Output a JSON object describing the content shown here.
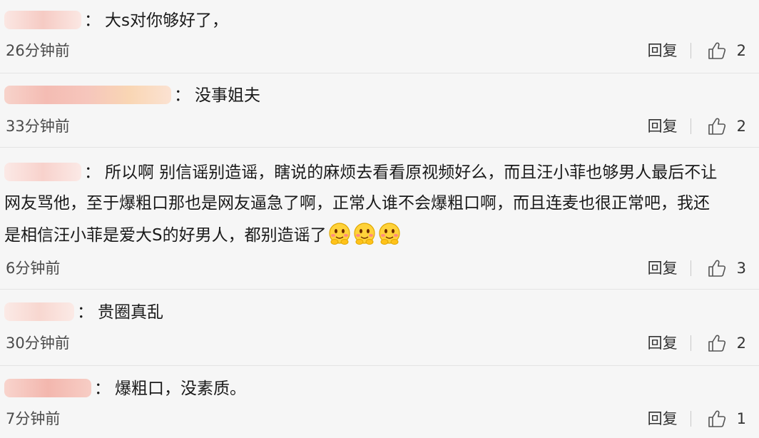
{
  "separator": "：",
  "reply_label": "回复",
  "comments": [
    {
      "text": "大s对你够好了，",
      "time": "26分钟前",
      "likes": "2"
    },
    {
      "text": "没事姐夫",
      "time": "33分钟前",
      "likes": "2"
    },
    {
      "lines": [
        "所以啊 别信谣别造谣，瞎说的麻烦去看看原视频好么，而且汪小菲也够男人最后不让",
        "网友骂他，至于爆粗口那也是网友逼急了啊，正常人谁不会爆粗口啊，而且连麦也很正常吧，我还",
        "是相信汪小菲是爱大S的好男人，都别造谣了"
      ],
      "time": "6分钟前",
      "likes": "3"
    },
    {
      "text": "贵圈真乱",
      "time": "30分钟前",
      "likes": "2"
    },
    {
      "text": "爆粗口，没素质。",
      "time": "7分钟前",
      "likes": "1"
    }
  ],
  "colors": {
    "background": "#f6f6f6",
    "divider": "#e4e4e4",
    "text": "#1a1a1a",
    "meta": "#4a4a4a",
    "username_blur": "#f2bcb4",
    "emoji": "#ffd23a"
  },
  "icons": [
    "thumbs-up-icon",
    "blushing-emoji-icon"
  ]
}
